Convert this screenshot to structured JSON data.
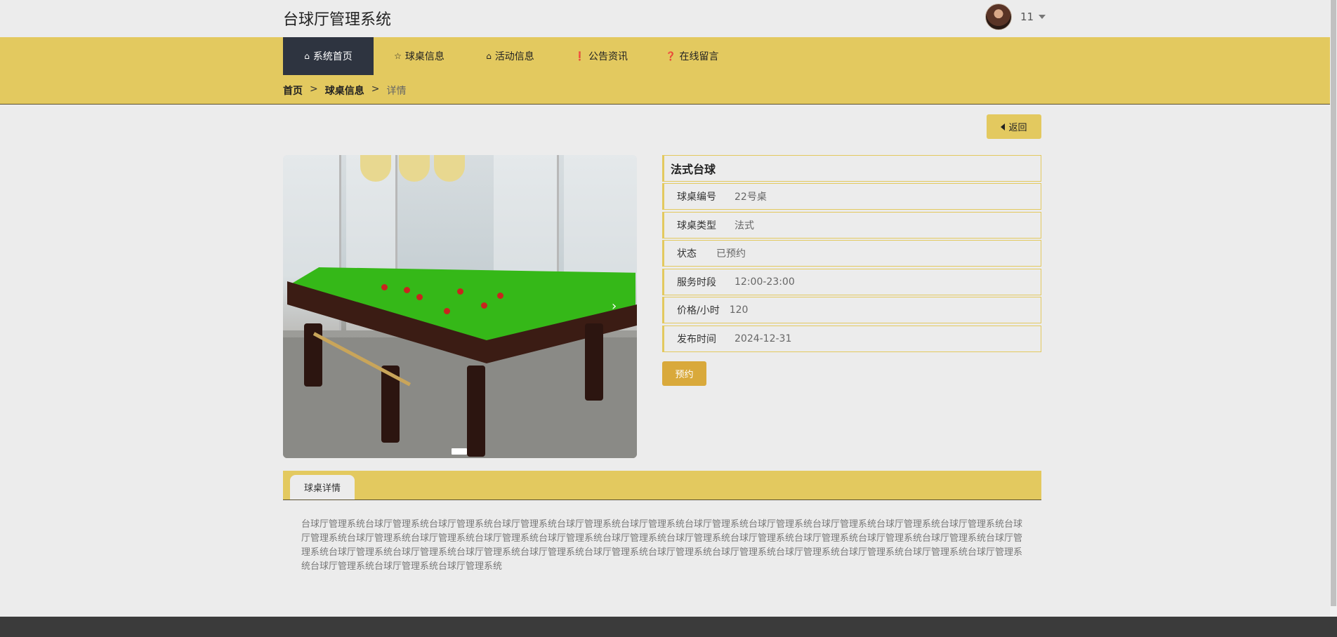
{
  "app": {
    "title": "台球厅管理系统"
  },
  "user": {
    "name": "11",
    "avatar_icon": "user-avatar",
    "menu_icon": "caret-down-icon"
  },
  "nav": {
    "items": [
      {
        "label": "系统首页",
        "icon": "home-icon",
        "active": true
      },
      {
        "label": "球桌信息",
        "icon": "star-icon",
        "active": false
      },
      {
        "label": "活动信息",
        "icon": "bag-icon",
        "active": false
      },
      {
        "label": "公告资讯",
        "icon": "exclamation-circle-icon",
        "active": false
      },
      {
        "label": "在线留言",
        "icon": "question-circle-icon",
        "active": false
      }
    ]
  },
  "breadcrumb": {
    "home": "首页",
    "section": "球桌信息",
    "current": "详情",
    "separator": ">"
  },
  "actions": {
    "back_label": "返回",
    "book_label": "预约"
  },
  "detail": {
    "title": "法式台球",
    "fields": [
      {
        "label": "球桌编号",
        "value": "22号桌"
      },
      {
        "label": "球桌类型",
        "value": "法式"
      },
      {
        "label": "状态",
        "value": "已预约"
      },
      {
        "label": "服务时段",
        "value": "12:00-23:00"
      },
      {
        "label": "价格/小时",
        "value": "120"
      },
      {
        "label": "发布时间",
        "value": "2024-12-31"
      }
    ]
  },
  "tabs": {
    "detail_label": "球桌详情"
  },
  "description": "台球厅管理系统台球厅管理系统台球厅管理系统台球厅管理系统台球厅管理系统台球厅管理系统台球厅管理系统台球厅管理系统台球厅管理系统台球厅管理系统台球厅管理系统台球厅管理系统台球厅管理系统台球厅管理系统台球厅管理系统台球厅管理系统台球厅管理系统台球厅管理系统台球厅管理系统台球厅管理系统台球厅管理系统台球厅管理系统台球厅管理系统台球厅管理系统台球厅管理系统台球厅管理系统台球厅管理系统台球厅管理系统台球厅管理系统台球厅管理系统台球厅管理系统台球厅管理系统台球厅管理系统台球厅管理系统台球厅管理系统台球厅管理系统台球厅管理系统",
  "colors": {
    "accent": "#e3c95f",
    "nav_active": "#2e3440",
    "book_button": "#d9a93b",
    "footer": "#3b3b3b"
  }
}
